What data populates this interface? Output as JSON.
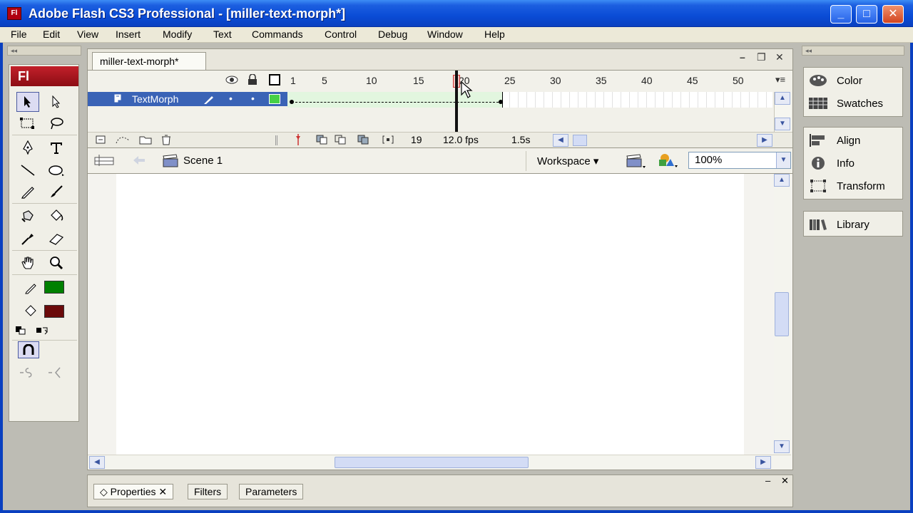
{
  "window": {
    "title": "Adobe Flash CS3 Professional - [miller-text-morph*]",
    "app_icon": "Fl",
    "min_glyph": "_",
    "max_glyph": "□",
    "close_glyph": "✕"
  },
  "menu": [
    "File",
    "Edit",
    "View",
    "Insert",
    "Modify",
    "Text",
    "Commands",
    "Control",
    "Debug",
    "Window",
    "Help"
  ],
  "toolbox": {
    "logo": "Fl",
    "handle": "◂◂",
    "stroke_color": "#008000",
    "fill_color": "#6b0a0a"
  },
  "document": {
    "tab": "miller-text-morph*",
    "min_glyph": "–",
    "restore_glyph": "❐",
    "close_glyph": "✕"
  },
  "timeline": {
    "frame_numbers": [
      "1",
      "5",
      "10",
      "15",
      "20",
      "25",
      "30",
      "35",
      "40",
      "45",
      "50"
    ],
    "layer_name": "TextMorph",
    "current_frame": "19",
    "fps": "12.0 fps",
    "time": "1.5s",
    "menu_glyph": "▾≡",
    "layer_dot1": "•",
    "layer_dot2": "•",
    "up_glyph": "▲",
    "down_glyph": "▼",
    "left_glyph": "◀",
    "right_glyph": "▶"
  },
  "editbar": {
    "scene": "Scene 1",
    "workspace": "Workspace ▾",
    "zoom": "100%",
    "zoom_arrow": "▼"
  },
  "stage": {
    "up_glyph": "▲",
    "down_glyph": "▼",
    "left_glyph": "◀",
    "right_glyph": "▶"
  },
  "properties": {
    "tabs": [
      "Properties",
      "Filters",
      "Parameters"
    ],
    "tab_close": "✕",
    "tab_diamond": "◇",
    "min_glyph": "–",
    "close_glyph": "✕"
  },
  "right_panels": {
    "handle": "◂◂",
    "group1": [
      "Color",
      "Swatches"
    ],
    "group2": [
      "Align",
      "Info",
      "Transform"
    ],
    "group3": [
      "Library"
    ]
  }
}
